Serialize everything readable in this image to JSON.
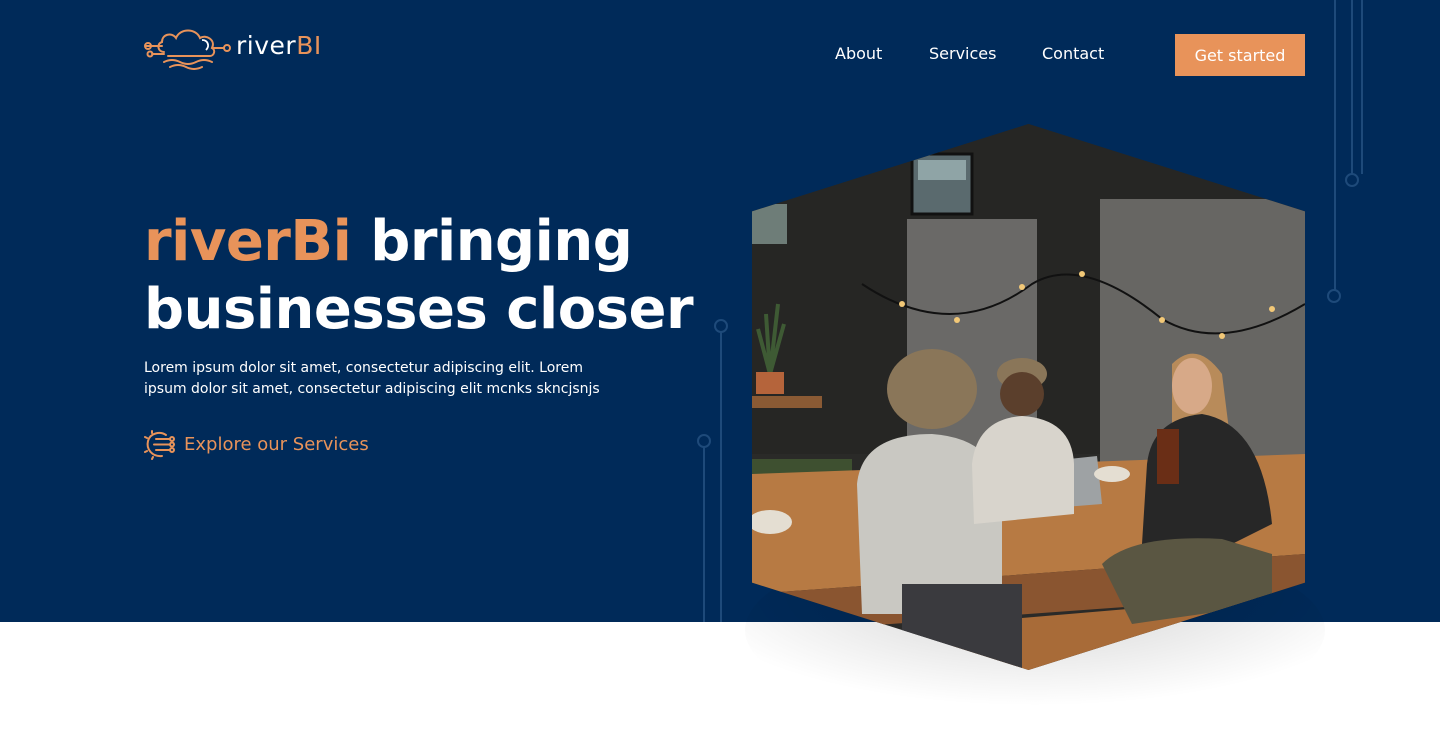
{
  "brand": {
    "name_main": "river",
    "name_accent": "BI"
  },
  "nav": {
    "items": [
      {
        "label": "About"
      },
      {
        "label": "Services"
      },
      {
        "label": "Contact"
      }
    ],
    "cta_label": "Get started"
  },
  "hero": {
    "headline_accent": "riverBi",
    "headline_rest": " bringing",
    "headline_line2": "businesses closer",
    "subtext": "Lorem ipsum dolor sit amet, consectetur adipiscing elit. Lorem ipsum dolor sit amet, consectetur adipiscing elit mcnks skncjsnjs",
    "explore_label": "Explore our Services"
  },
  "colors": {
    "navy": "#002a59",
    "accent": "#e8935a",
    "white": "#ffffff"
  },
  "icons": {
    "logo": "cloud-circuit-logo-icon",
    "explore": "circuit-icon"
  }
}
